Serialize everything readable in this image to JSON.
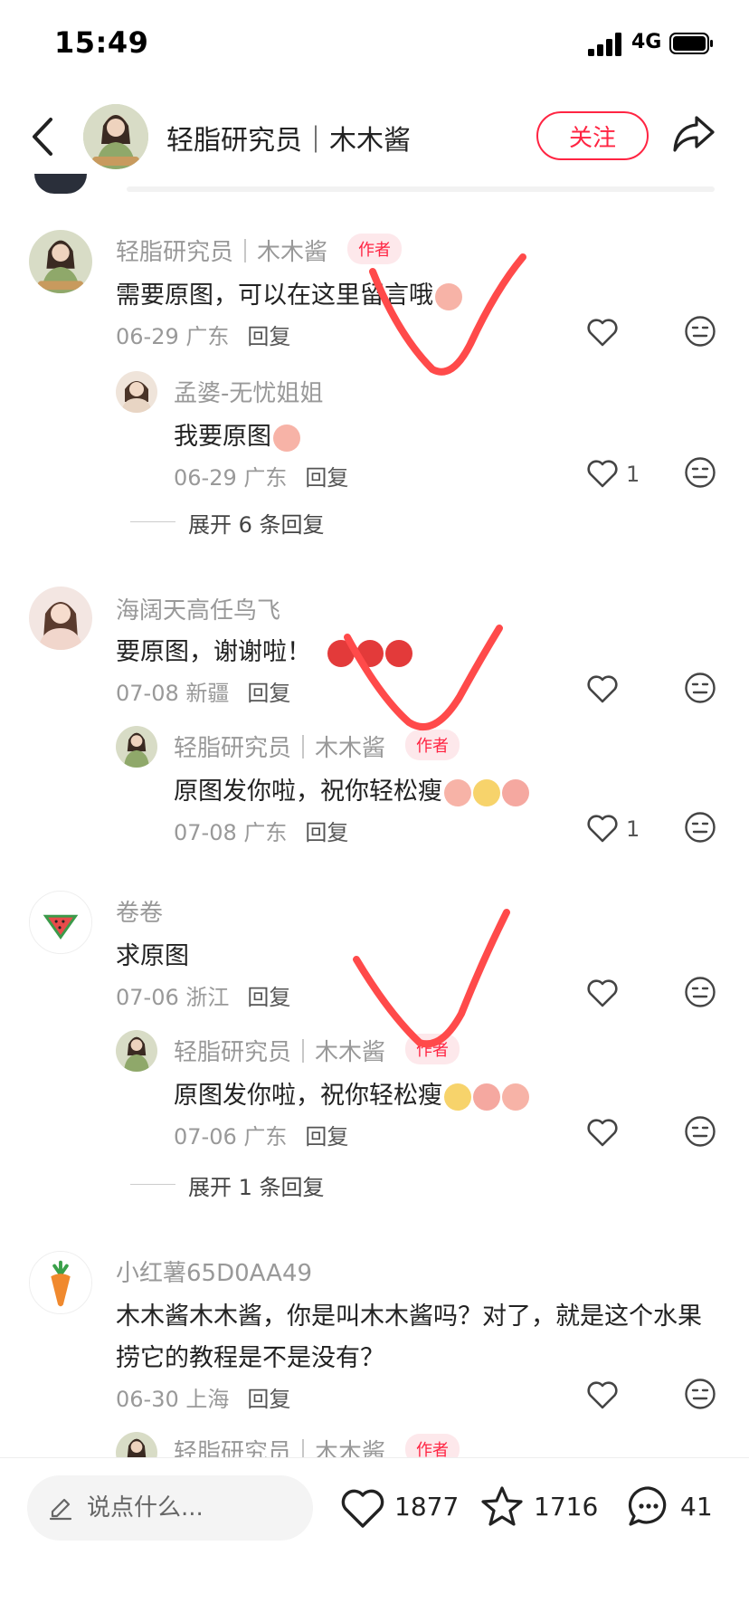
{
  "status_bar": {
    "time": "15:49",
    "network": "4G"
  },
  "header": {
    "author_name": "轻脂研究员｜木木酱",
    "follow_label": "关注"
  },
  "comments": [
    {
      "name": "轻脂研究员｜木木酱",
      "tag": "作者",
      "text": "需要原图，可以在这里留言哦",
      "date_loc": "06-29 广东",
      "reply": "回复",
      "likes": "",
      "replies": [
        {
          "name": "孟婆-无忧姐姐",
          "text": "我要原图",
          "date_loc": "06-29 广东",
          "reply": "回复",
          "likes": "1"
        }
      ],
      "expand": "展开 6 条回复"
    },
    {
      "name": "海阔天高任鸟飞",
      "text": "要原图，谢谢啦！",
      "date_loc": "07-08 新疆",
      "reply": "回复",
      "likes": "",
      "replies": [
        {
          "name": "轻脂研究员｜木木酱",
          "tag": "作者",
          "text": "原图发你啦，祝你轻松瘦",
          "date_loc": "07-08 广东",
          "reply": "回复",
          "likes": "1"
        }
      ]
    },
    {
      "name": "卷卷",
      "text": "求原图",
      "date_loc": "07-06 浙江",
      "reply": "回复",
      "likes": "",
      "replies": [
        {
          "name": "轻脂研究员｜木木酱",
          "tag": "作者",
          "text": "原图发你啦，祝你轻松瘦",
          "date_loc": "07-06 广东",
          "reply": "回复",
          "likes": ""
        }
      ],
      "expand": "展开 1 条回复"
    },
    {
      "name": "小红薯65D0AA49",
      "text_line1": "木木酱木木酱，你是叫木木酱吗？对了，就是这个水果",
      "text_line2": "捞它的教程是不是没有？",
      "date_loc": "06-30 上海",
      "reply": "回复",
      "likes": "",
      "replies": [
        {
          "name": "轻脂研究员｜木木酱",
          "tag": "作者"
        }
      ]
    }
  ],
  "bottom_bar": {
    "input_placeholder": "说点什么...",
    "likes": "1877",
    "collects": "1716",
    "comments": "41"
  },
  "colors": {
    "accent": "#ff2442",
    "check_mark": "#ff4a4a"
  }
}
